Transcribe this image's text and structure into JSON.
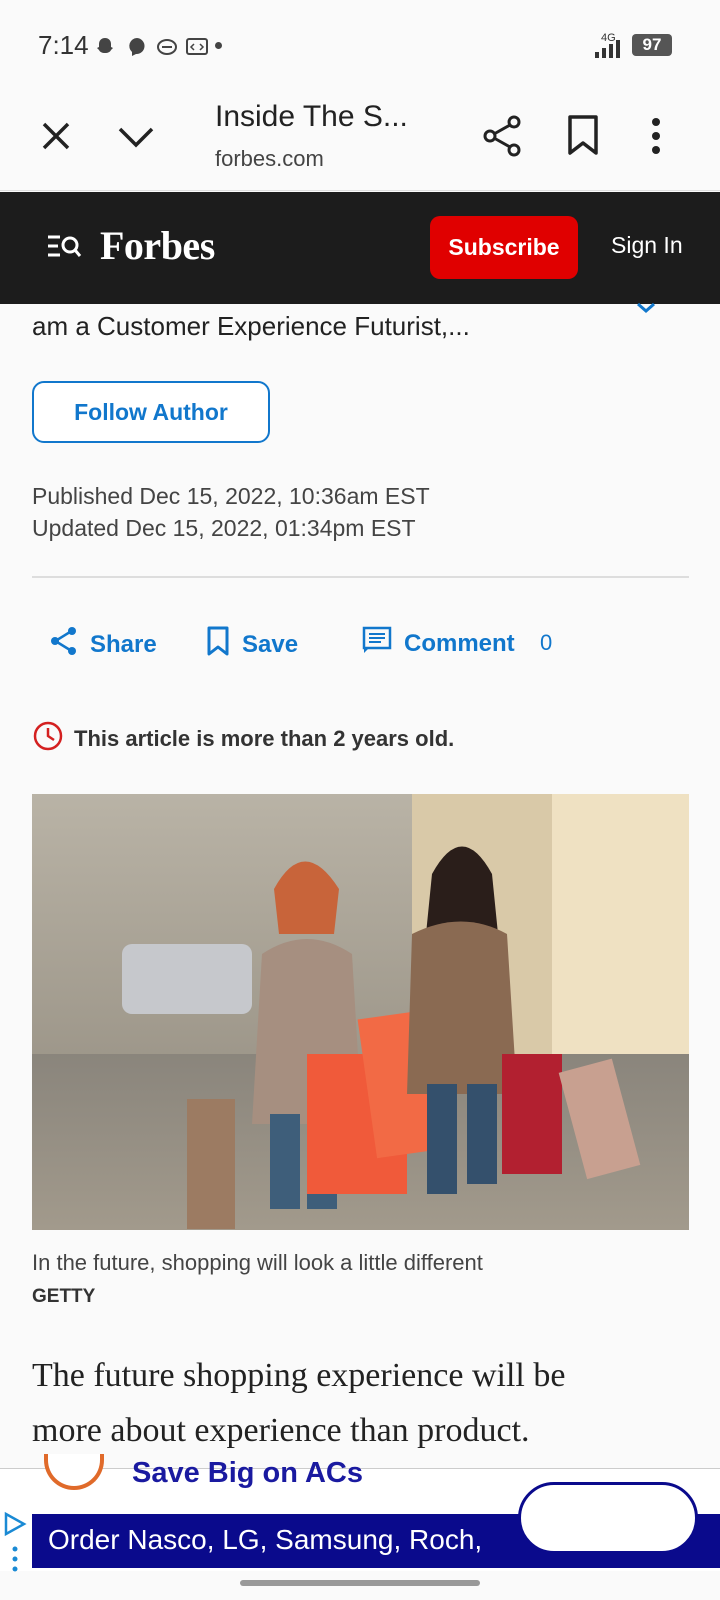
{
  "status_bar": {
    "time": "7:14",
    "network": "4G",
    "battery": "97",
    "notification_icons": [
      "snapchat-icon",
      "messenger-icon",
      "chat-icon",
      "code-icon",
      "dot-icon"
    ]
  },
  "browser": {
    "tab_title": "Inside The S...",
    "domain": "forbes.com",
    "icons": [
      "close-icon",
      "chevron-down-icon",
      "share-icon",
      "bookmark-icon",
      "more-vert-icon"
    ]
  },
  "header": {
    "logo": "Forbes",
    "subscribe_label": "Subscribe",
    "sign_in_label": "Sign In"
  },
  "article": {
    "author_bio_snippet": "am a Customer Experience Futurist,...",
    "follow_label": "Follow Author",
    "published": "Published Dec 15, 2022, 10:36am EST",
    "updated": "Updated Dec 15, 2022, 01:34pm EST",
    "actions": {
      "share_label": "Share",
      "save_label": "Save",
      "comment_label": "Comment",
      "comment_count": "0"
    },
    "old_notice": "This article is more than 2 years old.",
    "caption": "In the future, shopping will look a little different",
    "credit": "GETTY",
    "body_lines": [
      "The future shopping experience will be",
      "more about experience than product."
    ]
  },
  "ad": {
    "headline": "Save Big on ACs",
    "body": "Order Nasco, LG, Samsung, Roch,"
  },
  "colors": {
    "accent_blue": "#1177cc",
    "subscribe_red": "#e00000",
    "header_black": "#1c1c1c",
    "ad_navy": "#0a0a8c"
  }
}
